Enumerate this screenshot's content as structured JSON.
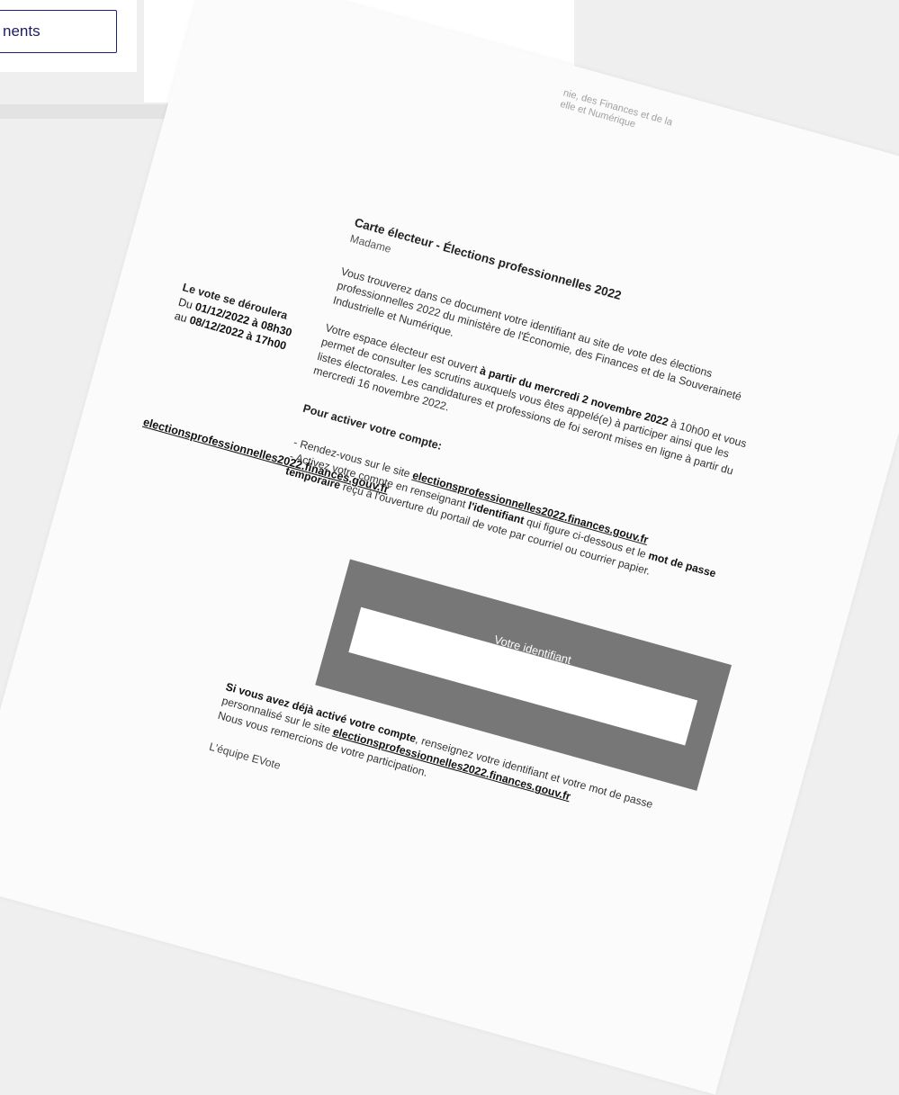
{
  "top_left_card": {
    "button_label": "nents"
  },
  "document": {
    "ministry_line1": "nie, des Finances et de la",
    "ministry_line2": "elle et Numérique",
    "title": "Carte électeur - Élections professionnelles 2022",
    "salutation": "Madame",
    "paragraph1": "Vous trouverez dans ce document votre identifiant au site de vote des élections professionnelles 2022 du ministère de l'Économie, des Finances et de la Souveraineté Industrielle et Numérique.",
    "paragraph2_pre": "Votre espace électeur est ouvert ",
    "paragraph2_bold": "à partir du mercredi 2 novembre 2022",
    "paragraph2_post": " à 10h00 et vous permet de consulter les scrutins auxquels vous êtes appelé(e) à participer ainsi que les listes électorales. Les candidatures et professions de foi seront mises en ligne à partir du mercredi 16 novembre 2022.",
    "activate_heading": "Pour activer votre compte:",
    "step1_pre": "- Rendez-vous sur le site ",
    "step1_link": "electionsprofessionnelles2022.finances.gouv.fr",
    "step2_pre": "- Activez votre compte en renseignant ",
    "step2_bold1": "l'identifiant",
    "step2_mid": " qui figure ci-dessous et le ",
    "step2_bold2": "mot de passe temporaire",
    "step2_post": " reçu à l'ouverture du portail de vote par courriel ou courrier papier.",
    "sidebar_vote_title": "Le vote se déroulera",
    "sidebar_vote_from_pre": "Du ",
    "sidebar_vote_from": "01/12/2022 à 08h30",
    "sidebar_vote_to_pre": "au ",
    "sidebar_vote_to": "08/12/2022 à 17h00",
    "sidebar_link": "electionsprofessionnelles2022.finances.gouv.fr",
    "identifier_header": "Votre identifiant",
    "closing_bold": "Si vous avez déjà activé votre compte",
    "closing_text": ", renseignez votre identifiant et votre mot de passe personnalisé sur le site ",
    "closing_link": "electionsprofessionnelles2022.finances.gouv.fr",
    "thanks": "Nous vous remercions de votre participation.",
    "signature": "L'équipe EVote"
  }
}
